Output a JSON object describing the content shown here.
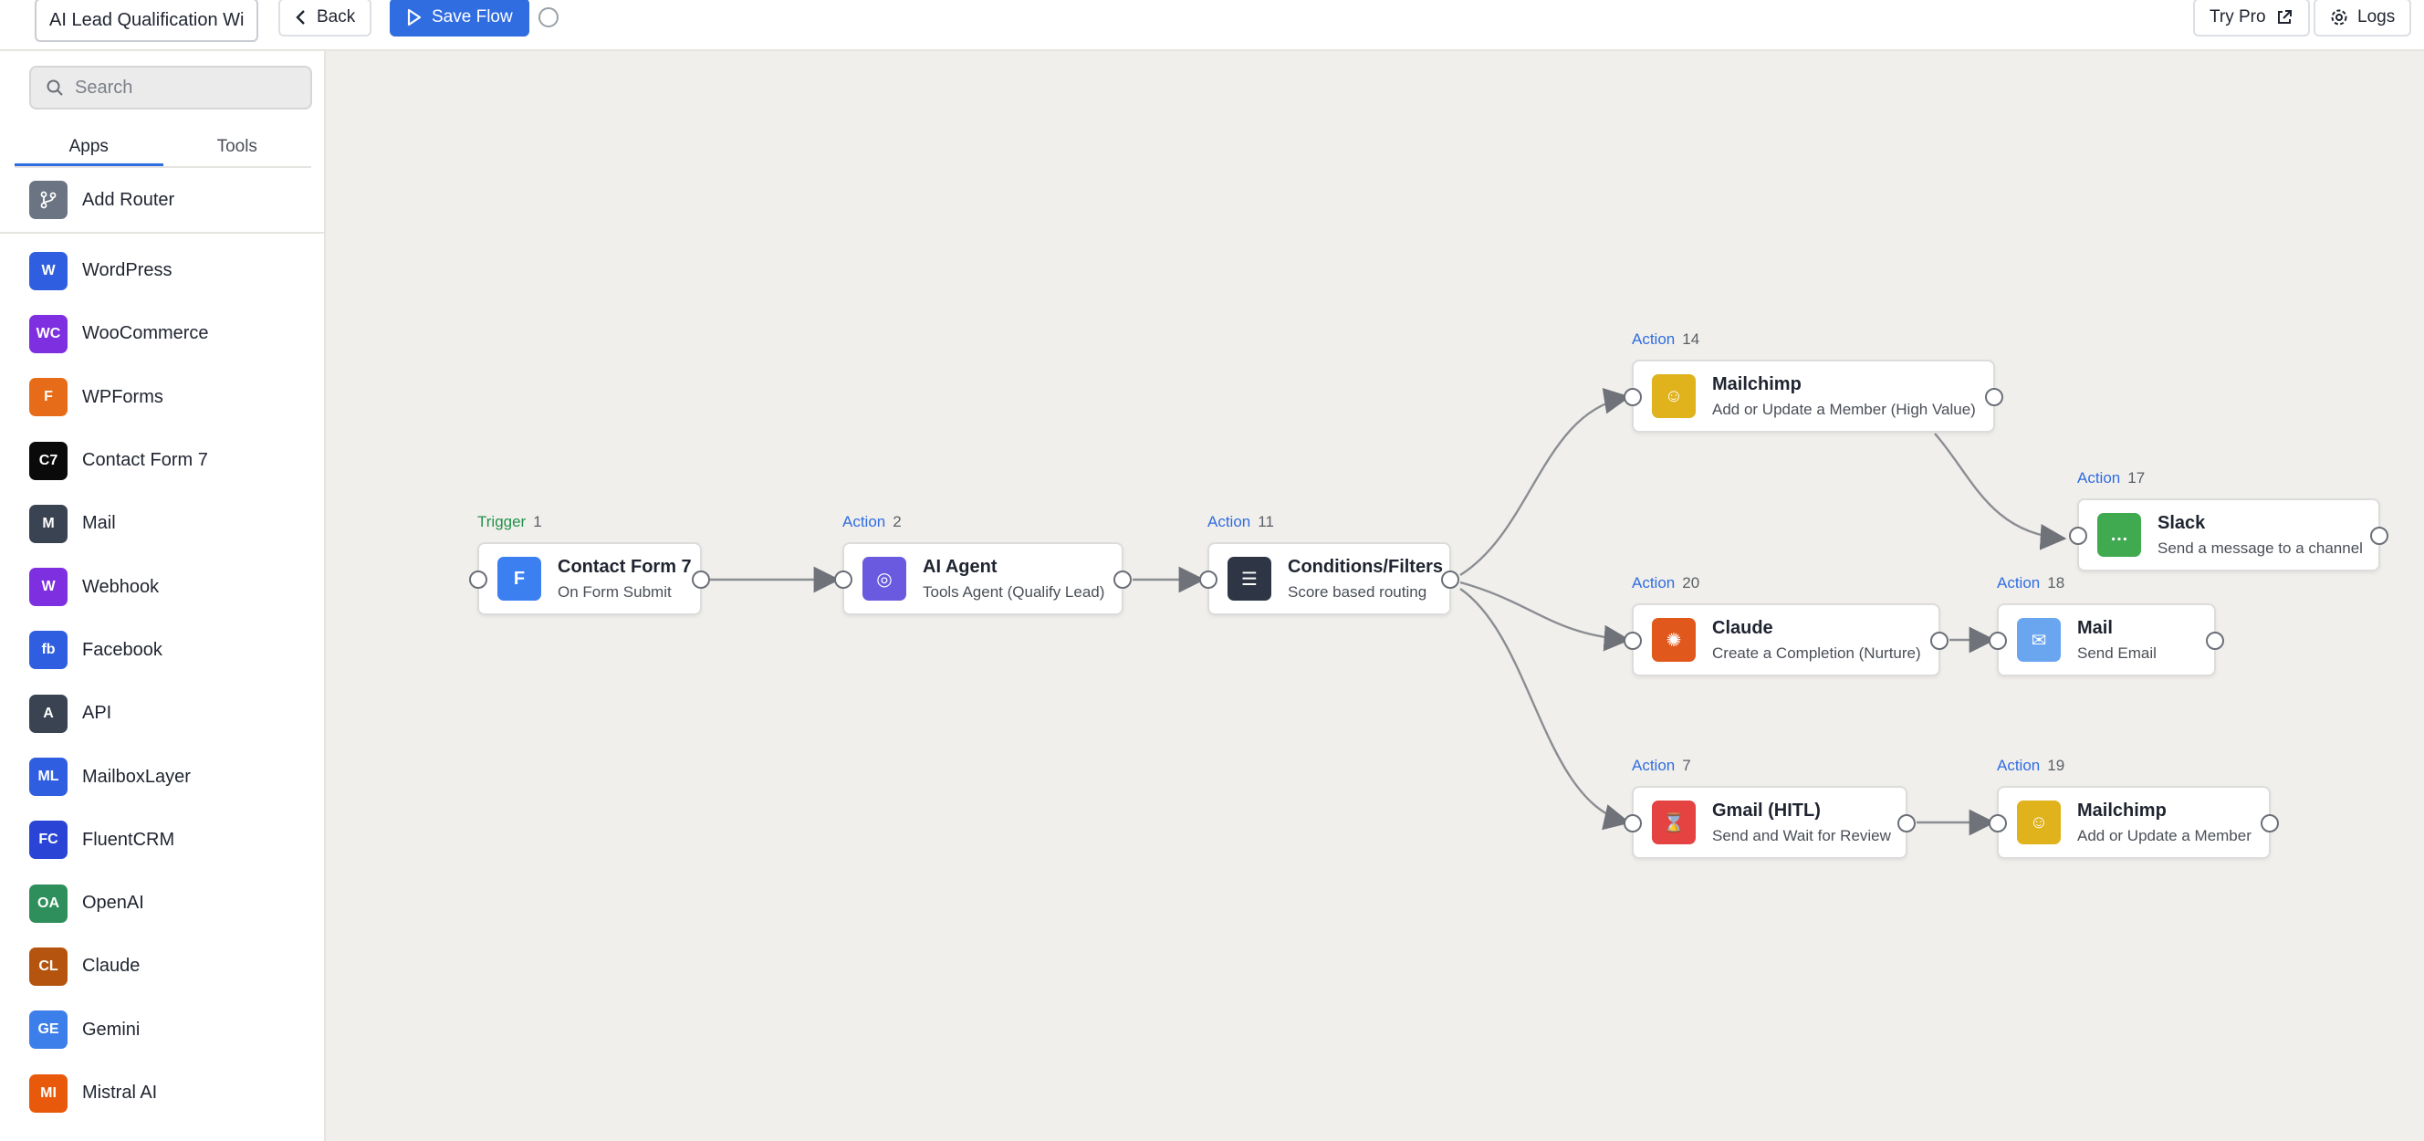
{
  "header": {
    "flow_name": "AI Lead Qualification Wi",
    "back_label": "Back",
    "save_label": "Save Flow",
    "try_pro_label": "Try Pro",
    "logs_label": "Logs"
  },
  "sidebar": {
    "search_placeholder": "Search",
    "tabs": [
      {
        "label": "Apps",
        "active": true
      },
      {
        "label": "Tools",
        "active": false
      }
    ],
    "router": {
      "label": "Add Router"
    },
    "apps": [
      {
        "abbr": "W",
        "label": "WordPress",
        "color": "#2f5fe0"
      },
      {
        "abbr": "WC",
        "label": "WooCommerce",
        "color": "#7e2fe0"
      },
      {
        "abbr": "F",
        "label": "WPForms",
        "color": "#e76c1a"
      },
      {
        "abbr": "C7",
        "label": "Contact Form 7",
        "color": "#0a0a0a"
      },
      {
        "abbr": "M",
        "label": "Mail",
        "color": "#3a4352"
      },
      {
        "abbr": "W",
        "label": "Webhook",
        "color": "#7e2fe0"
      },
      {
        "abbr": "fb",
        "label": "Facebook",
        "color": "#2f5fe0"
      },
      {
        "abbr": "A",
        "label": "API",
        "color": "#3a4352"
      },
      {
        "abbr": "ML",
        "label": "MailboxLayer",
        "color": "#2f5fe0"
      },
      {
        "abbr": "FC",
        "label": "FluentCRM",
        "color": "#2a45d6"
      },
      {
        "abbr": "OA",
        "label": "OpenAI",
        "color": "#2f8f5c"
      },
      {
        "abbr": "CL",
        "label": "Claude",
        "color": "#b5540f"
      },
      {
        "abbr": "GE",
        "label": "Gemini",
        "color": "#3d7fea"
      },
      {
        "abbr": "MI",
        "label": "Mistral AI",
        "color": "#e8590c"
      }
    ]
  },
  "canvas": {
    "nodes": [
      {
        "id": "n1",
        "kind": "Trigger",
        "num": "1",
        "title": "Contact Form 7",
        "sub": "On Form Submit",
        "icon": "form-icon",
        "icon_text": "F",
        "icon_color": "#3b7ff0"
      },
      {
        "id": "n2",
        "kind": "Action",
        "num": "2",
        "title": "AI Agent",
        "sub": "Tools Agent (Qualify Lead)",
        "icon": "robot-icon",
        "icon_text": "◎",
        "icon_color": "#6a5ae0"
      },
      {
        "id": "n11",
        "kind": "Action",
        "num": "11",
        "title": "Conditions/Filters",
        "sub": "Score based routing",
        "icon": "filter-icon",
        "icon_text": "☰",
        "icon_color": "#2e3645"
      },
      {
        "id": "n14",
        "kind": "Action",
        "num": "14",
        "title": "Mailchimp",
        "sub": "Add or Update a Member (High Value)",
        "icon": "mailchimp-icon",
        "icon_text": "☺",
        "icon_color": "#e0b21c"
      },
      {
        "id": "n17",
        "kind": "Action",
        "num": "17",
        "title": "Slack",
        "sub": "Send a message to a channel",
        "icon": "chat-icon",
        "icon_text": "…",
        "icon_color": "#3faa4f"
      },
      {
        "id": "n20",
        "kind": "Action",
        "num": "20",
        "title": "Claude",
        "sub": "Create a Completion (Nurture)",
        "icon": "claude-icon",
        "icon_text": "✺",
        "icon_color": "#e0581c"
      },
      {
        "id": "n18",
        "kind": "Action",
        "num": "18",
        "title": "Mail",
        "sub": "Send Email",
        "icon": "mail-icon",
        "icon_text": "✉",
        "icon_color": "#6aa5f0"
      },
      {
        "id": "n7",
        "kind": "Action",
        "num": "7",
        "title": "Gmail (HITL)",
        "sub": "Send and Wait for Review",
        "icon": "hourglass-icon",
        "icon_text": "⌛",
        "icon_color": "#e54242"
      },
      {
        "id": "n19",
        "kind": "Action",
        "num": "19",
        "title": "Mailchimp",
        "sub": "Add or Update a Member",
        "icon": "mailchimp-icon",
        "icon_text": "☺",
        "icon_color": "#e0b21c"
      }
    ]
  },
  "colors": {
    "accent": "#2f6de1",
    "trigger": "#22924b",
    "canvas_bg": "#f1efeb"
  }
}
